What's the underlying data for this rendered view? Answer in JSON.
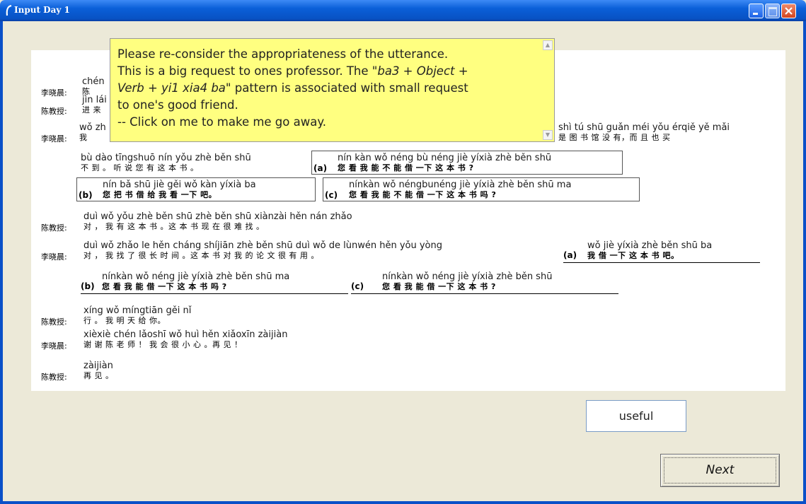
{
  "window": {
    "title": "Input Day 1"
  },
  "dialogue": {
    "r1": {
      "speaker": "李晓晨:",
      "segs": [
        {
          "py": "chén",
          "hz": "陈"
        }
      ]
    },
    "r2": {
      "speaker": "陈教授:",
      "segs": [
        {
          "py": "jìn lái",
          "hz": "进 来"
        }
      ]
    },
    "r3": {
      "speaker": "李晓晨:",
      "segs": [
        {
          "py": "wǒ zh",
          "hz": "我"
        },
        {
          "py": "shì tú shū guǎn méi yǒu érqiě yě mǎi",
          "hz": "是 图  书   馆   没   有，而 且  也  买"
        }
      ]
    },
    "r4": {
      "segs": [
        {
          "py": "bù dào  tīngshuō nín  yǒu zhè běn shū",
          "hz": "不  到 。 听  说    您    有   这   本  书 。"
        }
      ]
    },
    "r4opt": {
      "label": "(a)",
      "py": "nín  kàn wǒ néng bù néng jiè yíxià zhè běn shū",
      "hz": "您    看   我   能    不   能   借 一下  这   本   书 ?"
    },
    "r5a": {
      "label": "(b)",
      "py": "nín bǎ shū jiè gěi wǒ kàn yíxià ba",
      "hz": "您  把  书  借  给  我   看  一下  吧。"
    },
    "r5b": {
      "label": "(c)",
      "py": "nínkàn wǒ néngbunéng jiè yíxià zhè běn shū ma",
      "hz": "您  看   我   能  不  能   借 一下   这    本   书   吗 ?"
    },
    "r6": {
      "speaker": "陈教授:",
      "segs": [
        {
          "py": "duì   wǒ yǒu zhè běn shū  zhè běn shū xiànzài hěn   nán zhǎo",
          "hz": "对 ， 我  有    这   本   书 。这   本    书  现  在   很     难   找  。"
        }
      ]
    },
    "r7": {
      "speaker": "李晓晨:",
      "segs": [
        {
          "py": "duì   wǒ zhǎo le hěn cháng shíjiān  zhè běn shū duì wǒ de lùnwén   hěn yǒu yòng",
          "hz": "对 ， 我   找   了 很    长     时  间 。这    本   书  对  我  的  论  文      很   有    用 。"
        }
      ]
    },
    "r7opt": {
      "label": "(a)",
      "py": "wǒ jiè yíxià zhè běn shū ba",
      "hz": "我  借  一下   这    本   书  吧。"
    },
    "r8a": {
      "label": "(b)",
      "py": "nínkàn wǒ néng jiè yíxià zhè běn shū ma",
      "hz": "您  看   我    能   借 一下   这    本   书   吗 ?"
    },
    "r8b": {
      "label": "(c)",
      "py": "nínkàn wǒ néng jiè yíxià zhè běn shū",
      "hz": "您  看   我    能   借 一下   这    本   书 ?"
    },
    "r9": {
      "speaker": "陈教授:",
      "segs": [
        {
          "py": "xíng   wǒ míngtiān gěi nǐ",
          "hz": "行 。 我    明   天   给  你。"
        }
      ]
    },
    "r10": {
      "speaker": "李晓晨:",
      "segs": [
        {
          "py": "xièxiè chén lǎoshī  wǒ huì hěn xiǎoxīn  zàijiàn",
          "hz": "谢  谢    陈     老  师 ！ 我  会    很    小  心 。再  见 ！"
        }
      ]
    },
    "r11": {
      "speaker": "陈教授:",
      "segs": [
        {
          "py": "zàijiàn",
          "hz": "再  见 。"
        }
      ]
    }
  },
  "tooltip": {
    "line1": "Please re-consider the appropriateness of the utterance.",
    "line2a": "This is a big request to ones professor. The \"",
    "line2b": "ba3 + Object +",
    "line3a": "Verb + yi1 xia4 ba\"",
    "line3b": " pattern is associated with small request",
    "line4": "to one's good friend.",
    "line5": "-- Click on me to make me go away."
  },
  "feedback": {
    "value": "useful"
  },
  "buttons": {
    "next": "Next"
  }
}
